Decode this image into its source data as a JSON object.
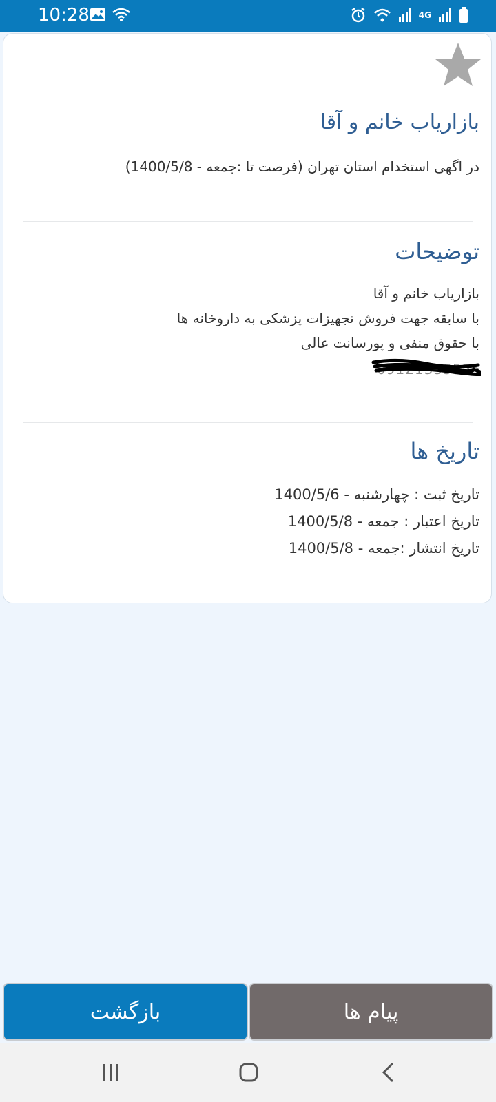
{
  "status_bar": {
    "time": "10:28",
    "left_icons": [
      "image-icon",
      "wifi-icon"
    ],
    "right_icons": [
      "alarm-icon",
      "wifi-icon",
      "signal-icon",
      "4g-icon",
      "signal-icon",
      "battery-icon"
    ],
    "network_label": "4G"
  },
  "ad": {
    "title": "بازاریاب خانم و آقا",
    "subtitle": "در اگهی استخدام استان تهران (فرصت تا :جمعه - 1400/5/8)"
  },
  "description": {
    "heading": "توضیحات",
    "lines": [
      "بازاریاب خانم و آقا",
      "با سابقه جهت فروش تجهیزات پزشکی به داروخانه ها",
      "با حقوق منفی و پورسانت عالی"
    ],
    "phone": "09121355555"
  },
  "dates": {
    "heading": "تاریخ ها",
    "lines": [
      "تاریخ ثبت : چهارشنبه - 1400/5/6",
      "تاریخ اعتبار : جمعه - 1400/5/8",
      "تاریخ انتشار :جمعه - 1400/5/8"
    ]
  },
  "buttons": {
    "back_label": "بازگشت",
    "messages_label": "پیام ها"
  },
  "colors": {
    "accent": "#0a7bbd",
    "secondary_button": "#716a6a",
    "heading": "#2f5e93",
    "star": "#a9a9a9",
    "background": "#eef5fd"
  },
  "nav_icons": [
    "recent-apps-icon",
    "home-icon",
    "back-icon"
  ]
}
